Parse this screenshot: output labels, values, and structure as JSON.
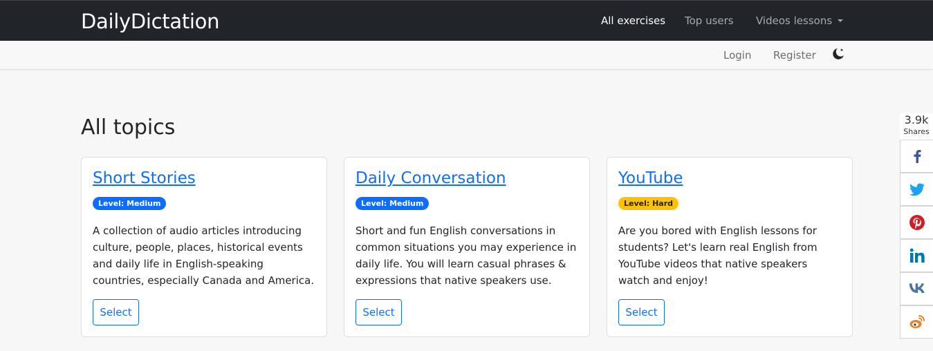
{
  "header": {
    "brand": "DailyDictation",
    "nav": [
      "All exercises",
      "Top users",
      "Videos lessons"
    ]
  },
  "subnav": {
    "login": "Login",
    "register": "Register",
    "theme_icon": "moon-icon"
  },
  "main": {
    "title": "All topics",
    "cards": [
      {
        "title": "Short Stories",
        "level": "Level: Medium",
        "description": "A collection of audio articles introducing culture, people, places, historical events and daily life in English-speaking countries, especially Canada and America.",
        "button": "Select"
      },
      {
        "title": "Daily Conversation",
        "level": "Level: Medium",
        "description": "Short and fun English conversations in common situations you may experience in daily life. You will learn casual phrases & expressions that native speakers use.",
        "button": "Select"
      },
      {
        "title": "YouTube",
        "level": "Level: Hard",
        "description": "Are you bored with English lessons for students? Let's learn real English from YouTube videos that native speakers watch and enjoy!",
        "button": "Select"
      }
    ]
  },
  "share": {
    "count": "3.9k",
    "label": "Shares",
    "networks": [
      "facebook-icon",
      "twitter-icon",
      "pinterest-icon",
      "linkedin-icon",
      "vk-icon",
      "weibo-icon"
    ]
  },
  "colors": {
    "navbar": "#212529",
    "primary": "#0d6efd",
    "warning": "#ffc107",
    "facebook": "#3b5998",
    "twitter": "#1da1f2",
    "pinterest": "#cb2027",
    "linkedin": "#0077b5",
    "vk": "#4c75a3",
    "weibo": "#e6842f"
  }
}
